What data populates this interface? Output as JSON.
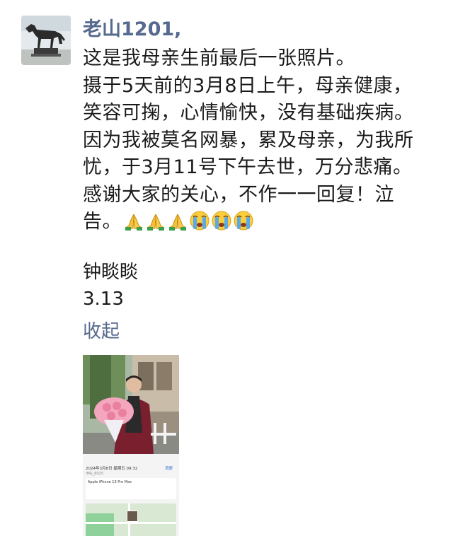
{
  "post": {
    "author": "老山1201,",
    "lines": [
      "这是我母亲生前最后一张照片。",
      "摄于5天前的3月8日上午，母亲健康，",
      "笑容可掬，心情愉快，没有基础疾病。",
      "因为我被莫名网暴，累及母亲，为我所",
      "忧，于3月11号下午去世，万分悲痛。",
      "感谢大家的关心，不作一一回复！泣",
      "告。"
    ],
    "emojis": [
      "folded-hands-icon",
      "folded-hands-icon",
      "folded-hands-icon",
      "crying-face-icon",
      "crying-face-icon",
      "crying-face-icon"
    ],
    "signature_name": "钟睒睒",
    "signature_date": "3.13",
    "collapse_label": "收起"
  },
  "photo_detail": {
    "device": "Apple iPhone 13 Pro Max",
    "date_text": "2024年3月8日 星期五 09:32",
    "edit_label": "调整",
    "file_id": "IMG_8025"
  },
  "colors": {
    "name_link": "#56698e",
    "text": "#1a1a1a",
    "background": "#ffffff"
  }
}
